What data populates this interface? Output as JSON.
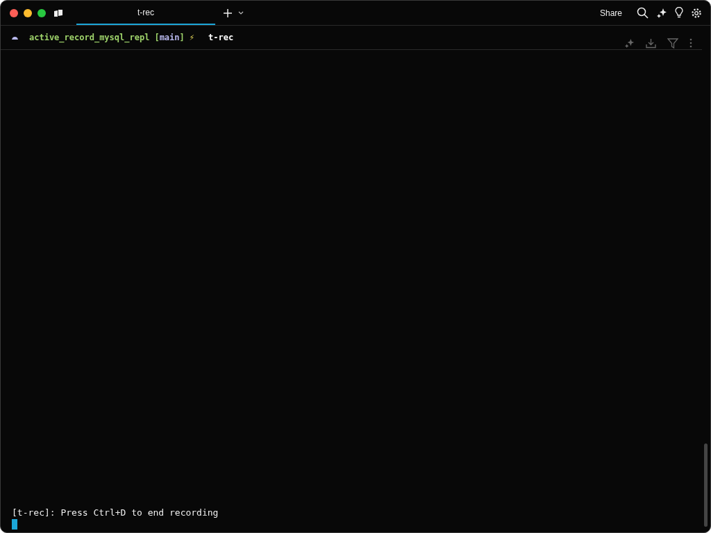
{
  "tabs": [
    {
      "label": "t-rec",
      "selected": true
    }
  ],
  "toolbar": {
    "share": "Share"
  },
  "prompt": {
    "directory": "active_record_mysql_repl",
    "branch_open": "[",
    "branch": "main",
    "branch_close": "]",
    "status": "⚡",
    "command": "t-rec"
  },
  "output": [
    "[t-rec]: Press Ctrl+D to end recording"
  ]
}
